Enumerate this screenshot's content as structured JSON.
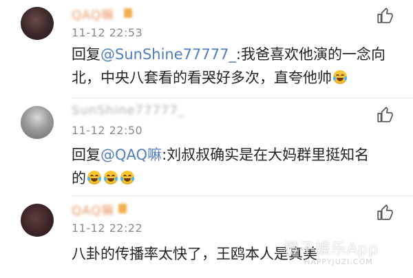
{
  "comments": [
    {
      "username": "QAQ嘛",
      "timestamp": "11-12 22:53",
      "reply_prefix": "回复",
      "mention": "@SunShine77777_",
      "text": ":我爸喜欢他演的一念向北，中央八套看的看哭好多次，直夸他帅",
      "emoji_count": 1
    },
    {
      "username": "SunShine77777_",
      "timestamp": "11-12 22:50",
      "reply_prefix": "回复",
      "mention": "@QAQ嘛",
      "text_line1": ":刘叔叔确实是在大妈群里挺知名",
      "text_line2": "的",
      "emoji_count": 3
    },
    {
      "username": "QAQ嘛",
      "timestamp": "11-12 22:22",
      "text": "八卦的传播率太快了，王鸥本人是真美"
    }
  ],
  "icons": {
    "like": "thumbs-up-icon",
    "emoji": "laughing-tears-emoji"
  },
  "colors": {
    "mention": "#4f7dbd",
    "username_orange": "#e07b3a",
    "timestamp": "#8a8a8a"
  },
  "watermark": {
    "brand": "橙子娱乐App",
    "url": "HAPPYJUZI.COM"
  }
}
